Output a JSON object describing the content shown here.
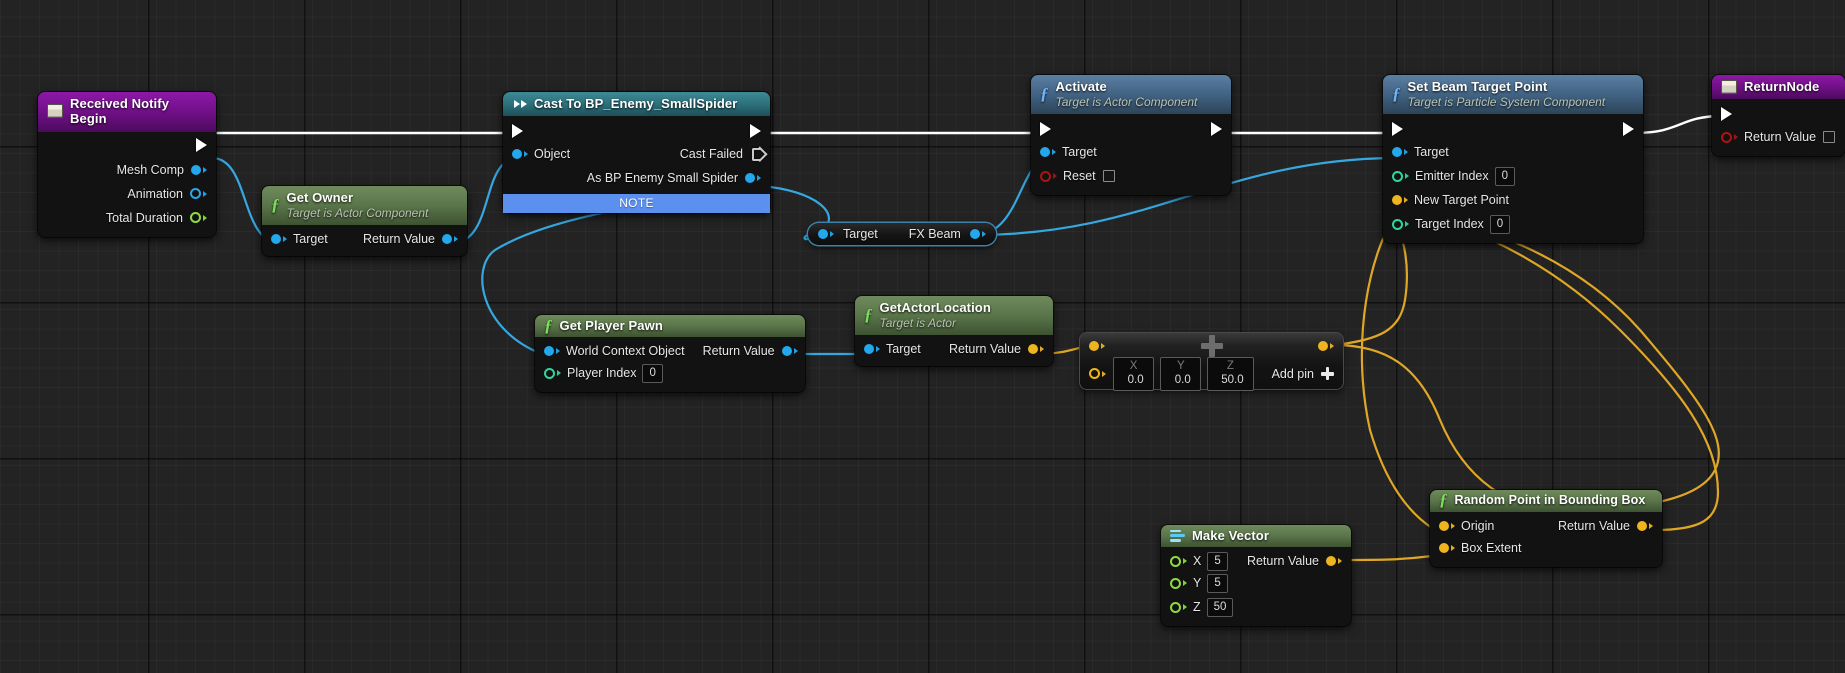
{
  "graph": {
    "app": "Unreal Engine Blueprint Event Graph",
    "background_color": "#232323",
    "wire_colors": {
      "exec": "#ffffff",
      "object": "#35a8e0",
      "vector": "#e0a726"
    }
  },
  "nodes": {
    "received_notify_begin": {
      "title": "Received Notify Begin",
      "icon": "event-box-icon",
      "header_color": "#6d0f84",
      "pins_out": [
        {
          "label": "Mesh Comp",
          "type": "object",
          "color": "#23a8ee",
          "style": "filled"
        },
        {
          "label": "Animation",
          "type": "object",
          "color": "#23a8ee",
          "style": "hollow"
        },
        {
          "label": "Total Duration",
          "type": "float",
          "color": "#8cdd3a",
          "style": "hollow"
        }
      ]
    },
    "get_owner": {
      "title": "Get Owner",
      "subtitle": "Target is Actor Component",
      "icon": "function-f-icon",
      "header_color": "#5a7549",
      "pin_in": {
        "label": "Target",
        "type": "object",
        "color": "#23a8ee"
      },
      "pin_out": {
        "label": "Return Value",
        "type": "object",
        "color": "#23a8ee"
      }
    },
    "cast_to_bp_enemy_smallspider": {
      "title": "Cast To BP_Enemy_SmallSpider",
      "icon": "cast-arrows-icon",
      "header_color": "#2b6e79",
      "pin_in_object": {
        "label": "Object",
        "type": "object",
        "color": "#23a8ee"
      },
      "pin_out_cast_failed": {
        "label": "Cast Failed",
        "type": "exec"
      },
      "pin_out_as": {
        "label": "As BP Enemy Small Spider",
        "type": "object",
        "color": "#23a8ee"
      },
      "note_bar": "NOTE"
    },
    "fx_beam": {
      "pin_in": {
        "label": "Target",
        "type": "object",
        "color": "#23a8ee"
      },
      "pin_out": {
        "label": "FX Beam",
        "type": "object",
        "color": "#23a8ee"
      }
    },
    "activate": {
      "title": "Activate",
      "subtitle": "Target is Actor Component",
      "icon": "function-f-icon",
      "header_color": "#3f607f",
      "pins_in": [
        {
          "label": "Target",
          "type": "object",
          "color": "#23a8ee",
          "style": "filled"
        },
        {
          "label": "Reset",
          "type": "bool",
          "color": "#a81515",
          "style": "hollow",
          "value_checkbox": false
        }
      ]
    },
    "set_beam_target_point": {
      "title": "Set Beam Target Point",
      "subtitle": "Target is Particle System Component",
      "icon": "function-f-icon",
      "header_color": "#3f607f",
      "pins_in": [
        {
          "label": "Target",
          "type": "object",
          "color": "#23a8ee",
          "style": "filled"
        },
        {
          "label": "Emitter Index",
          "type": "int",
          "color": "#2fd6a0",
          "style": "hollow",
          "value": "0"
        },
        {
          "label": "New Target Point",
          "type": "vector",
          "color": "#efb520",
          "style": "filled"
        },
        {
          "label": "Target Index",
          "type": "int",
          "color": "#2fd6a0",
          "style": "hollow",
          "value": "0"
        }
      ]
    },
    "return_node": {
      "title": "ReturnNode",
      "icon": "event-box-icon",
      "header_color": "#6d0f84",
      "pin_in": {
        "label": "Return Value",
        "type": "bool",
        "color": "#a81515",
        "value_checkbox": false
      }
    },
    "get_player_pawn": {
      "title": "Get Player Pawn",
      "icon": "function-f-icon",
      "header_color": "#5a7549",
      "pins_in": [
        {
          "label": "World Context Object",
          "type": "object",
          "color": "#23a8ee",
          "style": "filled"
        },
        {
          "label": "Player Index",
          "type": "int",
          "color": "#2fd6a0",
          "style": "hollow",
          "value": "0"
        }
      ],
      "pin_out": {
        "label": "Return Value",
        "type": "object",
        "color": "#23a8ee"
      }
    },
    "get_actor_location": {
      "title": "GetActorLocation",
      "subtitle": "Target is Actor",
      "icon": "function-f-icon",
      "header_color": "#5a7549",
      "pin_in": {
        "label": "Target",
        "type": "object",
        "color": "#23a8ee"
      },
      "pin_out": {
        "label": "Return Value",
        "type": "vector",
        "color": "#efb520"
      }
    },
    "vector_add": {
      "icon": "plus-icon",
      "inputs": [
        {
          "axis": "X",
          "value": "0.0"
        },
        {
          "axis": "Y",
          "value": "0.0"
        },
        {
          "axis": "Z",
          "value": "50.0"
        }
      ],
      "add_pin_label": "Add pin",
      "pin_in_top": {
        "type": "vector",
        "color": "#efb520",
        "style": "filled"
      },
      "pin_in_bottom": {
        "type": "vector",
        "color": "#efb520",
        "style": "hollow"
      },
      "pin_out": {
        "type": "vector",
        "color": "#efb520",
        "style": "filled"
      }
    },
    "make_vector": {
      "title": "Make Vector",
      "icon": "make-vector-icon",
      "header_color": "#5a7549",
      "pins_in": [
        {
          "label": "X",
          "type": "float",
          "color": "#8cdd3a",
          "style": "hollow",
          "value": "5"
        },
        {
          "label": "Y",
          "type": "float",
          "color": "#8cdd3a",
          "style": "hollow",
          "value": "5"
        },
        {
          "label": "Z",
          "type": "float",
          "color": "#8cdd3a",
          "style": "hollow",
          "value": "50"
        }
      ],
      "pin_out": {
        "label": "Return Value",
        "type": "vector",
        "color": "#efb520"
      }
    },
    "random_point_in_bounding_box": {
      "title": "Random Point in Bounding Box",
      "icon": "function-f-icon",
      "header_color": "#5a7549",
      "pins_in": [
        {
          "label": "Origin",
          "type": "vector",
          "color": "#efb520",
          "style": "filled"
        },
        {
          "label": "Box Extent",
          "type": "vector",
          "color": "#efb520",
          "style": "filled"
        }
      ],
      "pin_out": {
        "label": "Return Value",
        "type": "vector",
        "color": "#efb520"
      }
    }
  }
}
